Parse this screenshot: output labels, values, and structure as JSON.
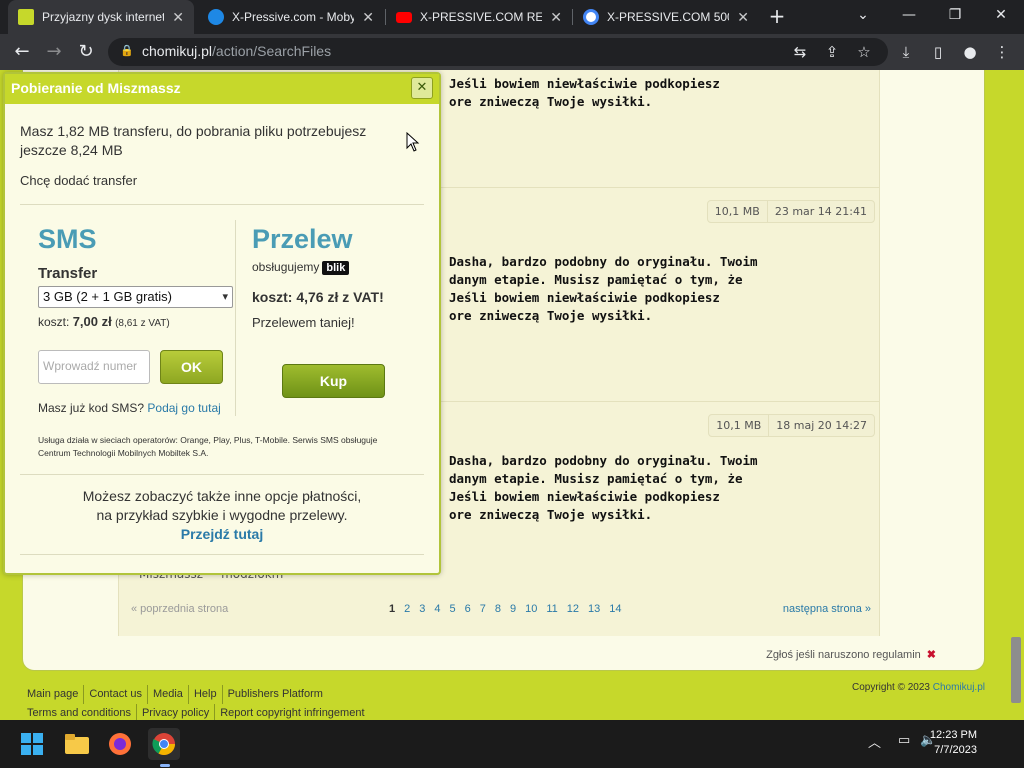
{
  "browser": {
    "tabs": [
      {
        "title": "Przyjazny dysk internet",
        "favicon_color": "#c6d82b",
        "active": true
      },
      {
        "title": "X-Pressive.com - Moby",
        "favicon_color": "#1e88e5",
        "active": false
      },
      {
        "title": "X-PRESSIVE.COM REVE",
        "favicon_color": "#ff0000",
        "active": false
      },
      {
        "title": "X-PRESSIVE.COM 500 -",
        "favicon_color": "#4285f4",
        "active": false
      }
    ],
    "url_host": "chomikuj.pl",
    "url_path": "/action/SearchFiles"
  },
  "modal": {
    "title": "Pobieranie od Miszmassz",
    "transfer_info": "Masz 1,82 MB transferu, do pobrania pliku potrzebujesz jeszcze 8,24 MB",
    "add_transfer": "Chcę dodać transfer",
    "sms": {
      "heading": "SMS",
      "transfer_label": "Transfer",
      "selected_option": "3 GB (2 + 1 GB gratis)",
      "cost_prefix": "koszt:",
      "cost": "7,00 zł",
      "cost_vat": "(8,61 z VAT)",
      "input_placeholder": "Wprowadź numer",
      "ok_label": "OK",
      "have_code": "Masz już kod SMS?",
      "have_code_link": "Podaj go tutaj",
      "note": "Usługa działa w sieciach operatorów: Orange, Play, Plus, T-Mobile. Serwis SMS obsługuje Centrum Technologii Mobilnych Mobiltek S.A."
    },
    "przelew": {
      "heading": "Przelew",
      "supports": "obsługujemy",
      "blik": "blik",
      "cost": "koszt: 4,76 zł z VAT!",
      "cheaper": "Przelewem taniej!",
      "buy_label": "Kup"
    },
    "other_options_line1": "Możesz zobaczyć także inne opcje płatności,",
    "other_options_line2": "na przykład szybkie i wygodne przelewy.",
    "other_options_link": "Przejdź tutaj"
  },
  "files": [
    {
      "desc_lines": [
        "Jeśli bowiem niewłaściwie podkopiesz",
        "ore zniweczą Twoje wysiłki."
      ]
    },
    {
      "size": "10,1 MB",
      "date": "23 mar 14 21:41",
      "desc_lines": [
        "Dasha, bardzo podobny do oryginału. Twoim",
        "danym etapie. Musisz pamiętać o tym, że",
        "Jeśli bowiem niewłaściwie podkopiesz",
        "ore zniweczą Twoje wysiłki."
      ]
    },
    {
      "size": "10,1 MB",
      "date": "18 maj 20 14:27",
      "desc_lines": [
        "Dasha, bardzo podobny do oryginału. Twoim",
        "danym etapie. Musisz pamiętać o tym, że",
        "Jeśli bowiem niewłaściwie podkopiesz",
        "ore zniweczą Twoje wysiłki."
      ]
    }
  ],
  "owners": [
    "Miszmassz",
    "modziokm"
  ],
  "pager": {
    "prev": "« poprzednia strona",
    "pages": [
      "1",
      "2",
      "3",
      "4",
      "5",
      "6",
      "7",
      "8",
      "9",
      "10",
      "11",
      "12",
      "13",
      "14"
    ],
    "next": "następna strona »"
  },
  "report": "Zgłoś jeśli naruszono regulamin",
  "footer": {
    "links": [
      "Main page",
      "Contact us",
      "Media",
      "Help",
      "Publishers Platform",
      "Terms and conditions",
      "Privacy policy",
      "Report copyright infringement"
    ],
    "copyright": "Copyright © 2023",
    "brand": "Chomikuj.pl"
  },
  "taskbar": {
    "time": "12:23 PM",
    "date": "7/7/2023"
  }
}
